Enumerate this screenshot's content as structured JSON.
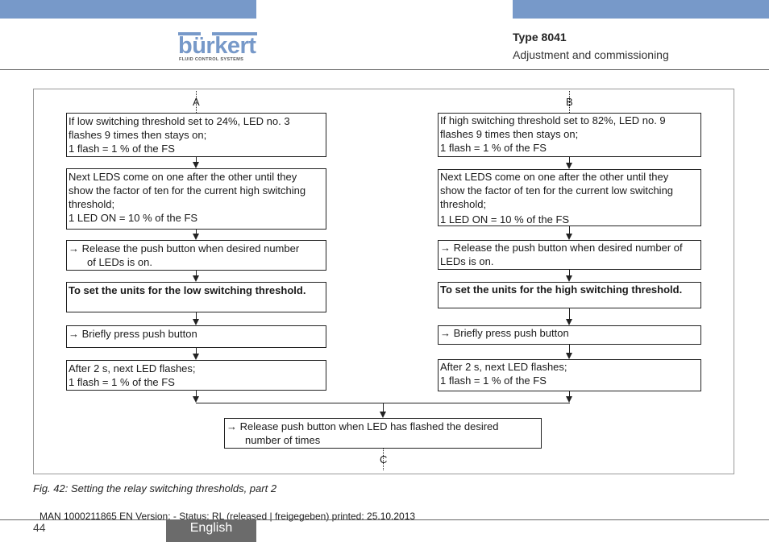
{
  "header": {
    "brand": {
      "name": "bürkert",
      "tagline": "FLUID CONTROL SYSTEMS",
      "color": "#7799c9"
    },
    "type": "Type 8041",
    "section": "Adjustment and commissioning"
  },
  "flowchart": {
    "connectors": {
      "left_in": "A",
      "right_in": "B",
      "out": "C"
    },
    "left": [
      {
        "lines": [
          "If low switching threshold set to 24%, LED no. 3",
          "flashes 9 times then stays on;",
          "1 flash = 1 % of the FS"
        ]
      },
      {
        "lines": [
          "Next LEDS come on one after the other until they",
          "show the factor of ten for the current high switching",
          "threshold;",
          "1 LED ON = 10 % of the FS"
        ]
      },
      {
        "lines": [
          "→ Release the push button when desired number",
          "of LEDs is on."
        ]
      },
      {
        "lines": [
          "To set the units for the low switching threshold."
        ]
      },
      {
        "lines": [
          "→ Briefly press push button"
        ]
      },
      {
        "lines": [
          "After 2 s, next LED flashes;",
          "1 flash = 1 % of the FS"
        ]
      }
    ],
    "right": [
      {
        "lines": [
          "If high switching threshold set to 82%, LED no. 9",
          "flashes 9 times then stays on;",
          "1 flash = 1 % of the FS"
        ]
      },
      {
        "lines": [
          "Next LEDS come on one after the other until they",
          "show the factor of ten for the current low switching",
          "threshold;",
          "1 LED ON = 10 % of the FS"
        ]
      },
      {
        "lines": [
          "→ Release the push button when desired number of",
          "LEDs is on."
        ]
      },
      {
        "lines": [
          "To set the units for the high switching threshold."
        ]
      },
      {
        "lines": [
          "→ Briefly press push button"
        ]
      },
      {
        "lines": [
          "After 2 s, next LED flashes;",
          "1 flash = 1 % of the FS"
        ]
      }
    ],
    "merge": {
      "lines": [
        "→ Release push button when LED has flashed the desired",
        "number of times"
      ]
    }
  },
  "caption": "Fig. 42:  Setting the relay switching thresholds, part 2",
  "footer": {
    "print_info": "MAN  1000211865  EN  Version: - Status: RL (released | freigegeben)  printed: 25.10.2013",
    "page_number": "44",
    "language": "English"
  }
}
